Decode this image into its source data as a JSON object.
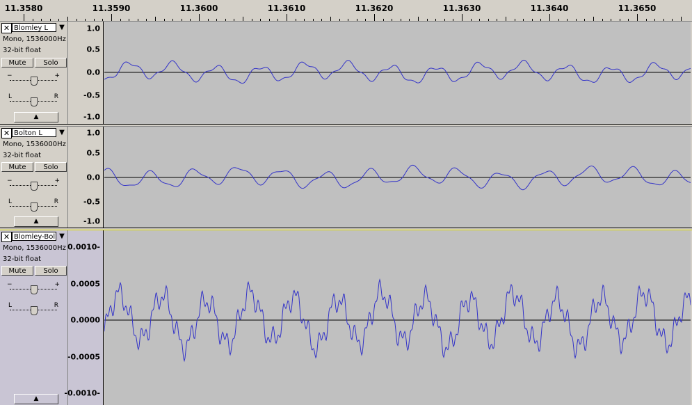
{
  "ruler": {
    "labels": [
      "11.3580",
      "11.3590",
      "11.3600",
      "11.3610",
      "11.3620",
      "11.3630",
      "11.3640",
      "11.3650"
    ]
  },
  "tracks": [
    {
      "name": "Blomley L",
      "info_line1": "Mono, 1536000Hz",
      "info_line2": "32-bit float",
      "mute_label": "Mute",
      "solo_label": "Solo",
      "gain_minus": "−",
      "gain_plus": "+",
      "pan_left": "L",
      "pan_right": "R",
      "scale_labels": [
        "1.0",
        "0.5",
        "0.0",
        "-0.5",
        "-1.0"
      ],
      "scale_range": [
        -1.0,
        1.0
      ]
    },
    {
      "name": "Bolton L",
      "info_line1": "Mono, 1536000Hz",
      "info_line2": "32-bit float",
      "mute_label": "Mute",
      "solo_label": "Solo",
      "gain_minus": "−",
      "gain_plus": "+",
      "pan_left": "L",
      "pan_right": "R",
      "scale_labels": [
        "1.0",
        "0.5",
        "0.0",
        "-0.5",
        "-1.0"
      ],
      "scale_range": [
        -1.0,
        1.0
      ]
    },
    {
      "name": "Blomley-Bol",
      "info_line1": "Mono, 1536000Hz",
      "info_line2": "32-bit float",
      "mute_label": "Mute",
      "solo_label": "Solo",
      "gain_minus": "−",
      "gain_plus": "+",
      "pan_left": "L",
      "pan_right": "R",
      "scale_labels": [
        "0.0010-",
        "0.0005",
        "0.0000",
        "-0.0005",
        "-0.0010-"
      ],
      "scale_range": [
        -0.001,
        0.001
      ]
    }
  ],
  "icons": {
    "close": "close-icon",
    "dropdown": "dropdown-arrow-icon",
    "collapse": "collapse-arrow-icon"
  },
  "colors": {
    "waveform": "#3232c8",
    "background": "#c0c0c0",
    "panel": "#d4d0c8"
  }
}
